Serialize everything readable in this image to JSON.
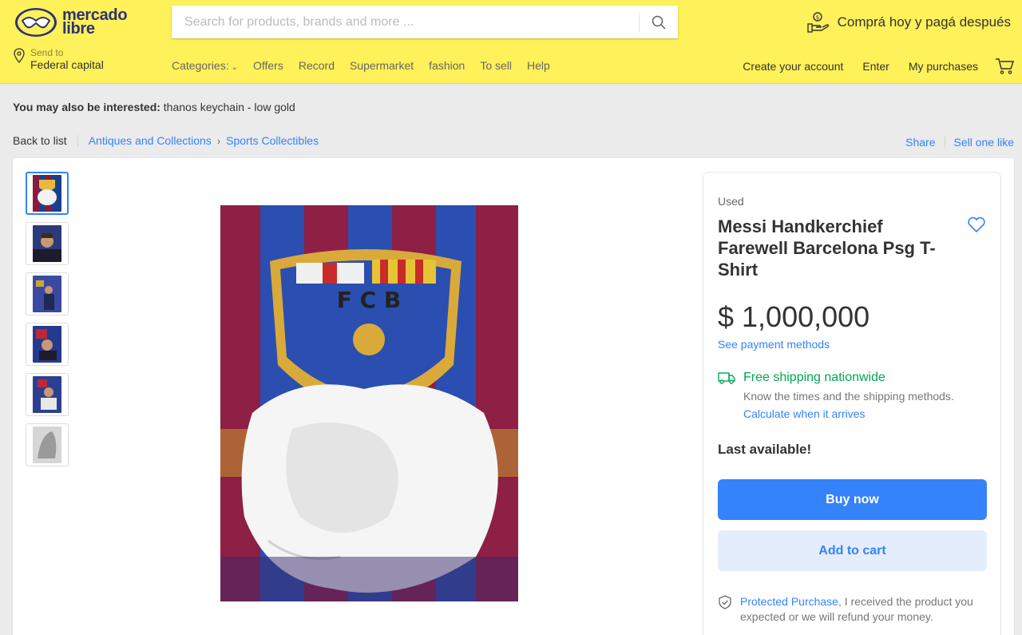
{
  "header": {
    "logo": {
      "line1": "mercado",
      "line2": "libre",
      "icon": "handshake-logo"
    },
    "search": {
      "placeholder": "Search for products, brands and more ...",
      "value": ""
    },
    "promo": "Comprá hoy y pagá después",
    "location": {
      "label": "Send to",
      "value": "Federal capital"
    },
    "nav": {
      "categories": "Categories:",
      "items": [
        "Offers",
        "Record",
        "Supermarket",
        "fashion",
        "To sell",
        "Help"
      ]
    },
    "account": {
      "create": "Create your account",
      "enter": "Enter",
      "purchases": "My purchases"
    }
  },
  "interest": {
    "label": "You may also be interested:",
    "value": "thanos keychain - low gold"
  },
  "breadcrumb": {
    "back": "Back to list",
    "items": [
      "Antiques and Collections",
      "Sports Collectibles"
    ],
    "share": "Share",
    "sell": "Sell one like"
  },
  "product": {
    "condition": "Used",
    "title": "Messi Handkerchief Farewell Barcelona Psg T-Shirt",
    "price": "$ 1,000,000",
    "payment_link": "See payment methods",
    "shipping": {
      "title": "Free shipping nationwide",
      "desc": "Know the times and the shipping methods.",
      "link": "Calculate when it arrives"
    },
    "stock": "Last available!",
    "buy_label": "Buy now",
    "cart_label": "Add to cart",
    "protect": {
      "link": "Protected Purchase",
      "text": ", I received the product you expected or we will refund your money."
    }
  },
  "colors": {
    "header": "#fff159",
    "accent": "#3483fa",
    "green": "#00a650"
  }
}
